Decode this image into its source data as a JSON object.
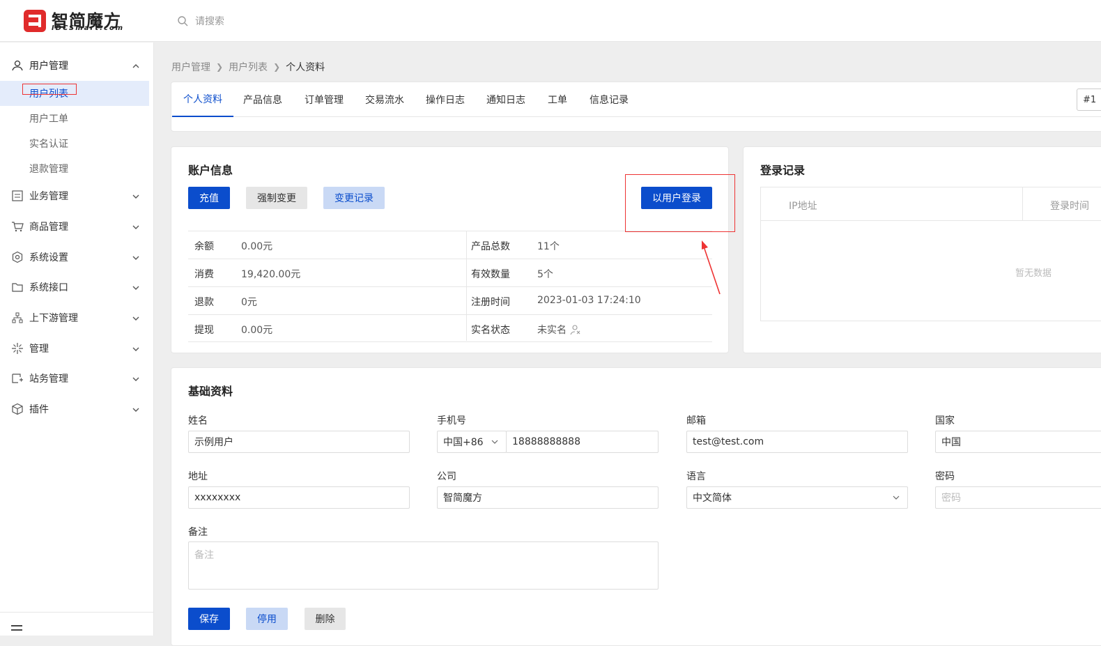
{
  "brand": {
    "name_cn": "智简魔方",
    "name_en": "IDCSmart.com"
  },
  "search": {
    "placeholder": "请搜索"
  },
  "sidebar": {
    "items": [
      {
        "label": "用户管理",
        "icon": "user-icon",
        "expanded": true
      },
      {
        "label": "业务管理",
        "icon": "list-icon"
      },
      {
        "label": "商品管理",
        "icon": "cart-icon"
      },
      {
        "label": "系统设置",
        "icon": "gear-icon"
      },
      {
        "label": "系统接口",
        "icon": "folder-icon"
      },
      {
        "label": "上下游管理",
        "icon": "network-icon"
      },
      {
        "label": "管理",
        "icon": "sparkle-icon"
      },
      {
        "label": "站务管理",
        "icon": "site-icon"
      },
      {
        "label": "插件",
        "icon": "cube-icon"
      }
    ],
    "subitems": [
      "用户列表",
      "用户工单",
      "实名认证",
      "退款管理"
    ],
    "active_sub": "用户列表"
  },
  "breadcrumb": [
    "用户管理",
    "用户列表",
    "个人资料"
  ],
  "tabs": [
    "个人资料",
    "产品信息",
    "订单管理",
    "交易流水",
    "操作日志",
    "通知日志",
    "工单",
    "信息记录"
  ],
  "tab_right": "#1",
  "account": {
    "title": "账户信息",
    "buttons": {
      "recharge": "充值",
      "force_change": "强制变更",
      "change_log": "变更记录",
      "login_as_user": "以用户登录"
    },
    "left_rows": [
      {
        "label": "余额",
        "value": "0.00元"
      },
      {
        "label": "消费",
        "value": "19,420.00元"
      },
      {
        "label": "退款",
        "value": "0元"
      },
      {
        "label": "提现",
        "value": "0.00元"
      }
    ],
    "right_rows": [
      {
        "label": "产品总数",
        "value": "11个"
      },
      {
        "label": "有效数量",
        "value": "5个"
      },
      {
        "label": "注册时间",
        "value": "2023-01-03 17:24:10"
      },
      {
        "label": "实名状态",
        "value": "未实名"
      }
    ]
  },
  "login_records": {
    "title": "登录记录",
    "columns": [
      "IP地址",
      "登录时间"
    ],
    "empty": "暂无数据"
  },
  "basic": {
    "title": "基础资料",
    "fields": {
      "name": {
        "label": "姓名",
        "value": "示例用户"
      },
      "phone": {
        "label": "手机号",
        "code": "中国+86",
        "value": "18888888888"
      },
      "email": {
        "label": "邮箱",
        "value": "test@test.com"
      },
      "country": {
        "label": "国家",
        "value": "中国"
      },
      "address": {
        "label": "地址",
        "value": "xxxxxxxx"
      },
      "company": {
        "label": "公司",
        "value": "智简魔方"
      },
      "language": {
        "label": "语言",
        "value": "中文简体"
      },
      "password": {
        "label": "密码",
        "placeholder": "密码"
      },
      "notes": {
        "label": "备注",
        "placeholder": "备注"
      }
    },
    "buttons": {
      "save": "保存",
      "disable": "停用",
      "delete": "删除"
    }
  },
  "colors": {
    "primary": "#0b4dcc",
    "annotation": "#e33333"
  }
}
